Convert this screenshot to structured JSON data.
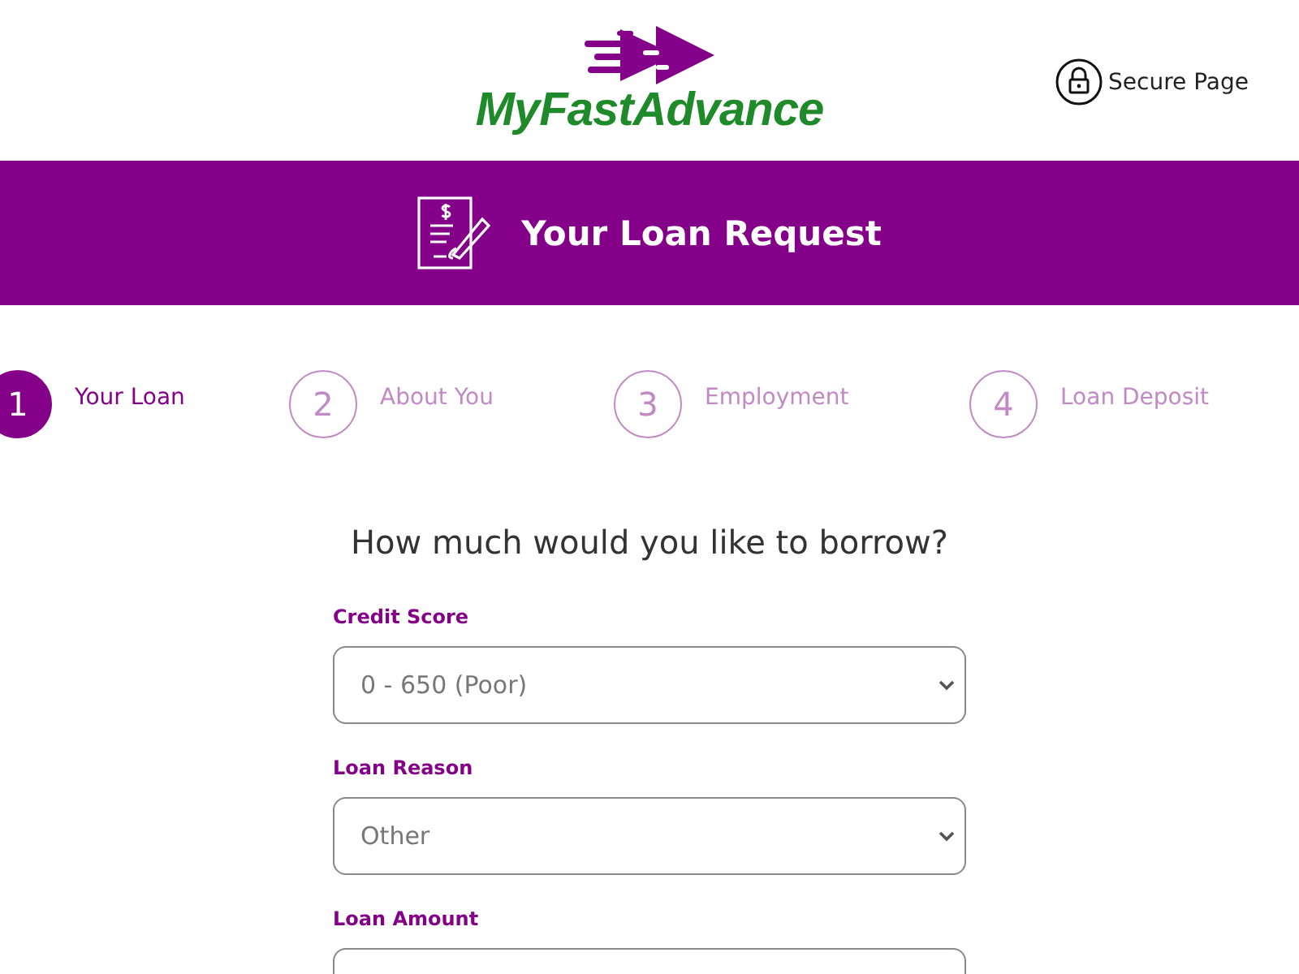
{
  "header": {
    "logo_text": "MyFastAdvance",
    "secure_label": "Secure Page"
  },
  "banner": {
    "title": "Your Loan Request"
  },
  "steps": [
    {
      "number": "1",
      "label": "Your Loan",
      "selected": true
    },
    {
      "number": "2",
      "label": "About You",
      "selected": false
    },
    {
      "number": "3",
      "label": "Employment",
      "selected": false
    },
    {
      "number": "4",
      "label": "Loan Deposit",
      "selected": false
    }
  ],
  "form": {
    "heading": "How much would you like to borrow?",
    "fields": [
      {
        "label": "Credit Score",
        "value": "0 - 650 (Poor)"
      },
      {
        "label": "Loan Reason",
        "value": "Other"
      },
      {
        "label": "Loan Amount"
      }
    ]
  }
}
